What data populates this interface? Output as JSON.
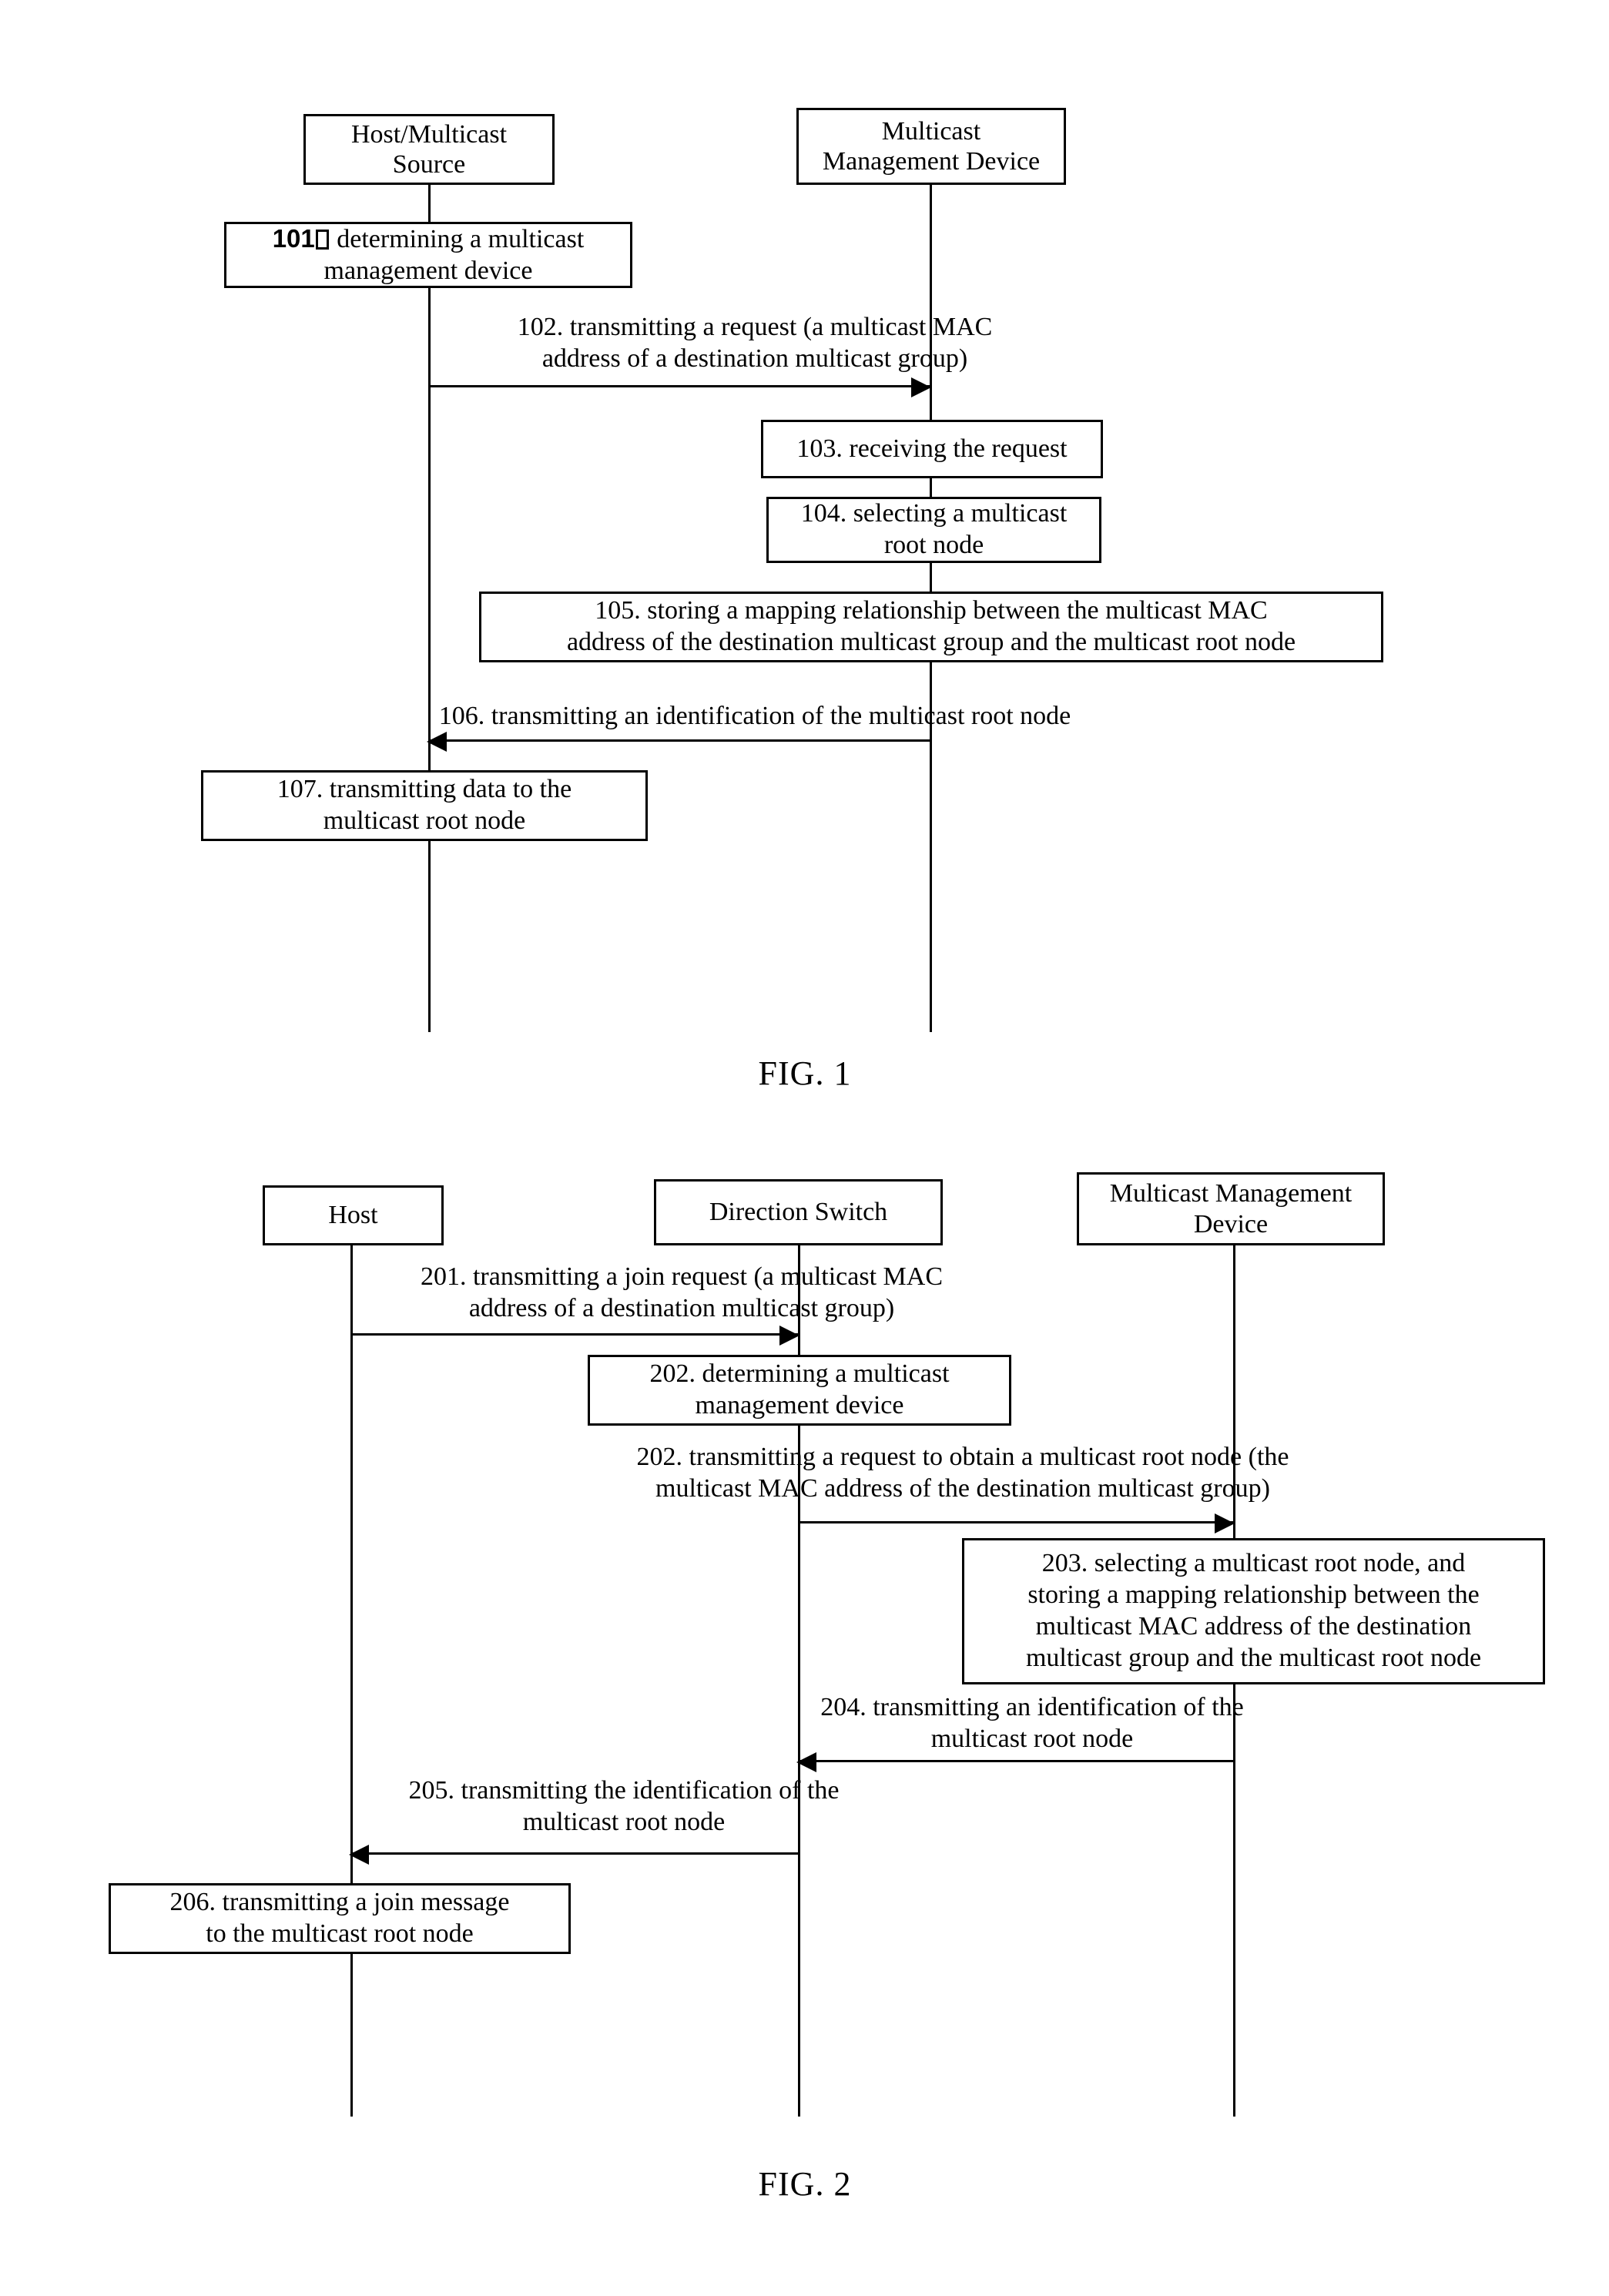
{
  "figures": [
    {
      "caption": "FIG. 1",
      "actors": [
        {
          "name": "host-multicast-source",
          "label": "Host/Multicast\nSource"
        },
        {
          "name": "multicast-management-device",
          "label": "Multicast\nManagement Device"
        }
      ],
      "steps": [
        {
          "name": "step-101",
          "kind": "box",
          "number": "101",
          "suffix_tofu": true,
          "label": "  determining a multicast\nmanagement device"
        },
        {
          "name": "step-102",
          "kind": "message",
          "label": "102. transmitting a request (a multicast MAC\naddress of a destination multicast group)",
          "direction": "right"
        },
        {
          "name": "step-103",
          "kind": "box",
          "label": "103. receiving the request"
        },
        {
          "name": "step-104",
          "kind": "box",
          "label": "104. selecting a multicast\nroot node"
        },
        {
          "name": "step-105",
          "kind": "box",
          "label": "105. storing a mapping relationship between the multicast MAC\naddress of the destination multicast group and the multicast root node"
        },
        {
          "name": "step-106",
          "kind": "message",
          "label": "106. transmitting an identification of the multicast root node",
          "direction": "left"
        },
        {
          "name": "step-107",
          "kind": "box",
          "label": "107. transmitting data to the\nmulticast root node"
        }
      ]
    },
    {
      "caption": "FIG. 2",
      "actors": [
        {
          "name": "host",
          "label": "Host"
        },
        {
          "name": "direction-switch",
          "label": "Direction Switch"
        },
        {
          "name": "multicast-management-device",
          "label": "Multicast Management\nDevice"
        }
      ],
      "steps": [
        {
          "name": "step-201",
          "kind": "message",
          "label": "201. transmitting a join request (a multicast MAC\naddress of a destination multicast group)",
          "direction": "right"
        },
        {
          "name": "step-202-determining",
          "kind": "box",
          "label": "202. determining a multicast\nmanagement device"
        },
        {
          "name": "step-202-transmitting",
          "kind": "message",
          "label": "202. transmitting a request to obtain a multicast root node (the\nmulticast MAC address of the destination multicast group)",
          "direction": "right"
        },
        {
          "name": "step-203",
          "kind": "box",
          "label": "203. selecting a multicast root node, and\nstoring a mapping relationship between the\nmulticast MAC address of the destination\nmulticast group and the multicast root node"
        },
        {
          "name": "step-204",
          "kind": "message",
          "label": "204. transmitting an identification of the\nmulticast root node",
          "direction": "left"
        },
        {
          "name": "step-205",
          "kind": "message",
          "label": "205. transmitting the identification of the\nmulticast root node",
          "direction": "left"
        },
        {
          "name": "step-206",
          "kind": "box",
          "label": "206. transmitting a join message\nto the multicast root node"
        }
      ]
    }
  ]
}
